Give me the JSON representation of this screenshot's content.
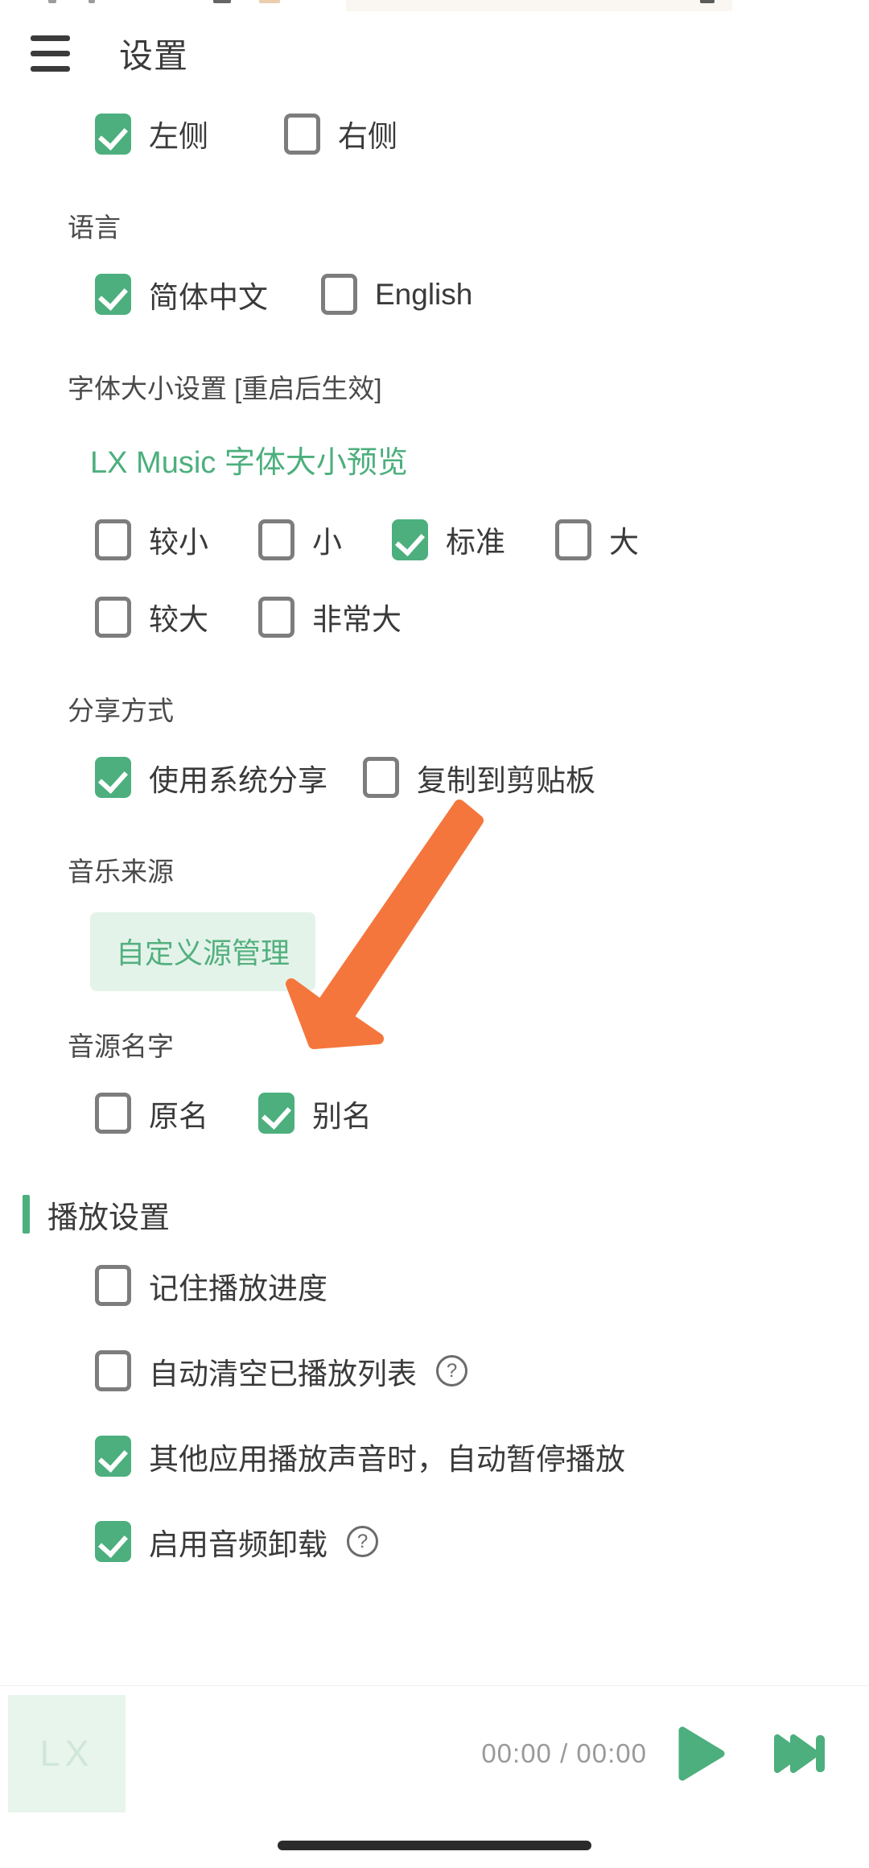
{
  "appbar": {
    "menu_icon": "hamburger-menu-icon",
    "title": "设置"
  },
  "settings": {
    "lyric_position": {
      "options": [
        {
          "label": "左侧",
          "checked": true
        },
        {
          "label": "右侧",
          "checked": false
        }
      ]
    },
    "language": {
      "label": "语言",
      "options": [
        {
          "label": "简体中文",
          "checked": true
        },
        {
          "label": "English",
          "checked": false
        }
      ]
    },
    "font_size": {
      "label": "字体大小设置 [重启后生效]",
      "preview": "LX Music 字体大小预览",
      "options_row1": [
        {
          "label": "较小",
          "checked": false
        },
        {
          "label": "小",
          "checked": false
        },
        {
          "label": "标准",
          "checked": true
        },
        {
          "label": "大",
          "checked": false
        }
      ],
      "options_row2": [
        {
          "label": "较大",
          "checked": false
        },
        {
          "label": "非常大",
          "checked": false
        }
      ]
    },
    "share_mode": {
      "label": "分享方式",
      "options": [
        {
          "label": "使用系统分享",
          "checked": true
        },
        {
          "label": "复制到剪贴板",
          "checked": false
        }
      ]
    },
    "music_source": {
      "label": "音乐来源",
      "button_label": "自定义源管理"
    },
    "source_name": {
      "label": "音源名字",
      "options": [
        {
          "label": "原名",
          "checked": false
        },
        {
          "label": "别名",
          "checked": true
        }
      ]
    },
    "playback": {
      "section_title": "播放设置",
      "items": [
        {
          "label": "记住播放进度",
          "checked": false,
          "help": false
        },
        {
          "label": "自动清空已播放列表",
          "checked": false,
          "help": true,
          "help_glyph": "?"
        },
        {
          "label": "其他应用播放声音时，自动暂停播放",
          "checked": true,
          "help": false
        },
        {
          "label": "启用音频卸载",
          "checked": true,
          "help": true,
          "help_glyph": "?"
        }
      ]
    }
  },
  "annotation": {
    "arrow_color": "#F4763C",
    "arrow_name": "pointer-arrow-to-custom-source-button"
  },
  "player": {
    "cover_placeholder": "LX",
    "time": "00:00 / 00:00",
    "play_icon": "play-icon",
    "next_icon": "next-track-icon"
  },
  "theme": {
    "accent": "#4CAF7D",
    "accent_soft": "#E4F3EA",
    "text": "#3A3A3A",
    "muted": "#9A9A9A"
  }
}
